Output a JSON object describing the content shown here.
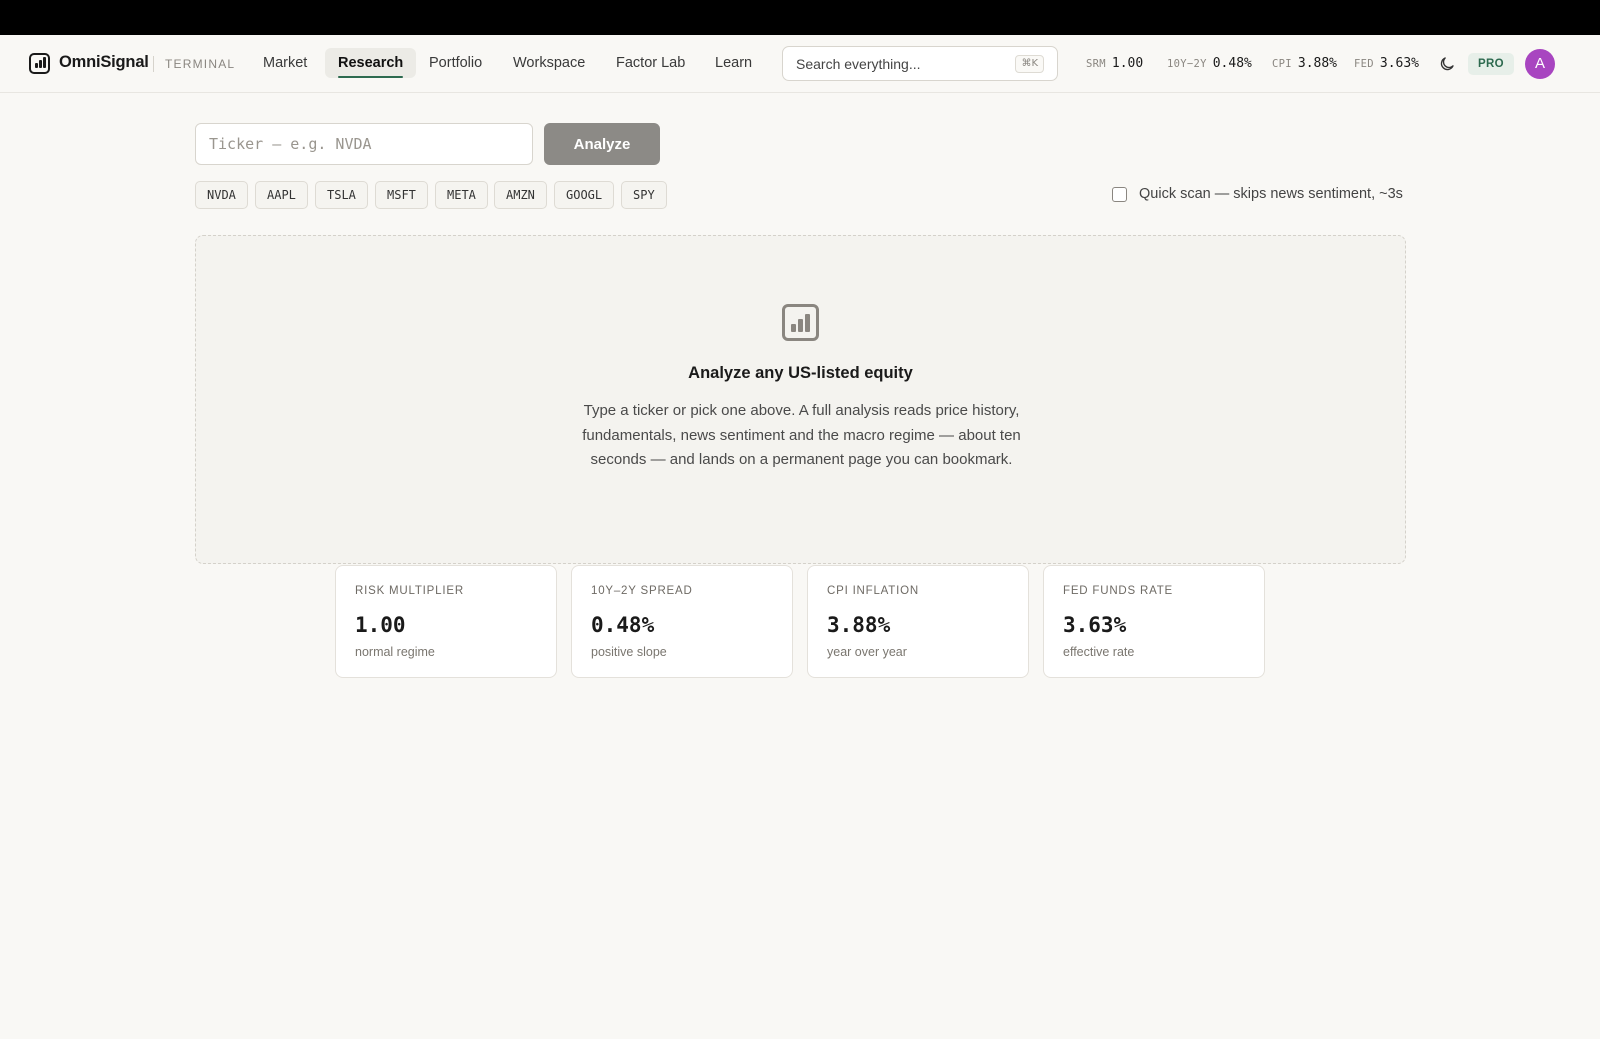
{
  "app": {
    "brand": "OmniSignal",
    "brand_sub": "TERMINAL",
    "accent_color": "#2d6a4f",
    "avatar_color": "#a845c0"
  },
  "nav": {
    "items": [
      {
        "label": "Market",
        "active": false
      },
      {
        "label": "Research",
        "active": true
      },
      {
        "label": "Portfolio",
        "active": false
      },
      {
        "label": "Workspace",
        "active": false
      },
      {
        "label": "Factor Lab",
        "active": false
      },
      {
        "label": "Learn",
        "active": false
      }
    ]
  },
  "search": {
    "placeholder": "Search everything...",
    "shortcut": "⌘K"
  },
  "tickers": [
    {
      "label": "SRM",
      "value": "1.00"
    },
    {
      "label": "10Y−2Y",
      "value": "0.48%"
    },
    {
      "label": "CPI",
      "value": "3.88%"
    },
    {
      "label": "FED",
      "value": "3.63%"
    }
  ],
  "header_right": {
    "theme_icon": "moon-icon",
    "plan_badge": "PRO",
    "avatar_initial": "A"
  },
  "analyze": {
    "input_placeholder": "Ticker — e.g. NVDA",
    "input_value": "",
    "button_label": "Analyze"
  },
  "quick_picks": [
    "NVDA",
    "AAPL",
    "TSLA",
    "MSFT",
    "META",
    "AMZN",
    "GOOGL",
    "SPY"
  ],
  "quick_scan": {
    "label": "Quick scan — skips news sentiment, ~3s",
    "checked": false
  },
  "empty_state": {
    "icon": "bar-chart-icon",
    "title": "Analyze any US-listed equity",
    "description": "Type a ticker or pick one above. A full analysis reads price history, fundamentals, news sentiment and the macro regime — about ten seconds — and lands on a permanent page you can bookmark."
  },
  "macro_cards": [
    {
      "label": "RISK MULTIPLIER",
      "value": "1.00",
      "sub": "normal regime"
    },
    {
      "label": "10Y–2Y SPREAD",
      "value": "0.48%",
      "sub": "positive slope"
    },
    {
      "label": "CPI INFLATION",
      "value": "3.88%",
      "sub": "year over year"
    },
    {
      "label": "FED FUNDS RATE",
      "value": "3.63%",
      "sub": "effective rate"
    }
  ]
}
